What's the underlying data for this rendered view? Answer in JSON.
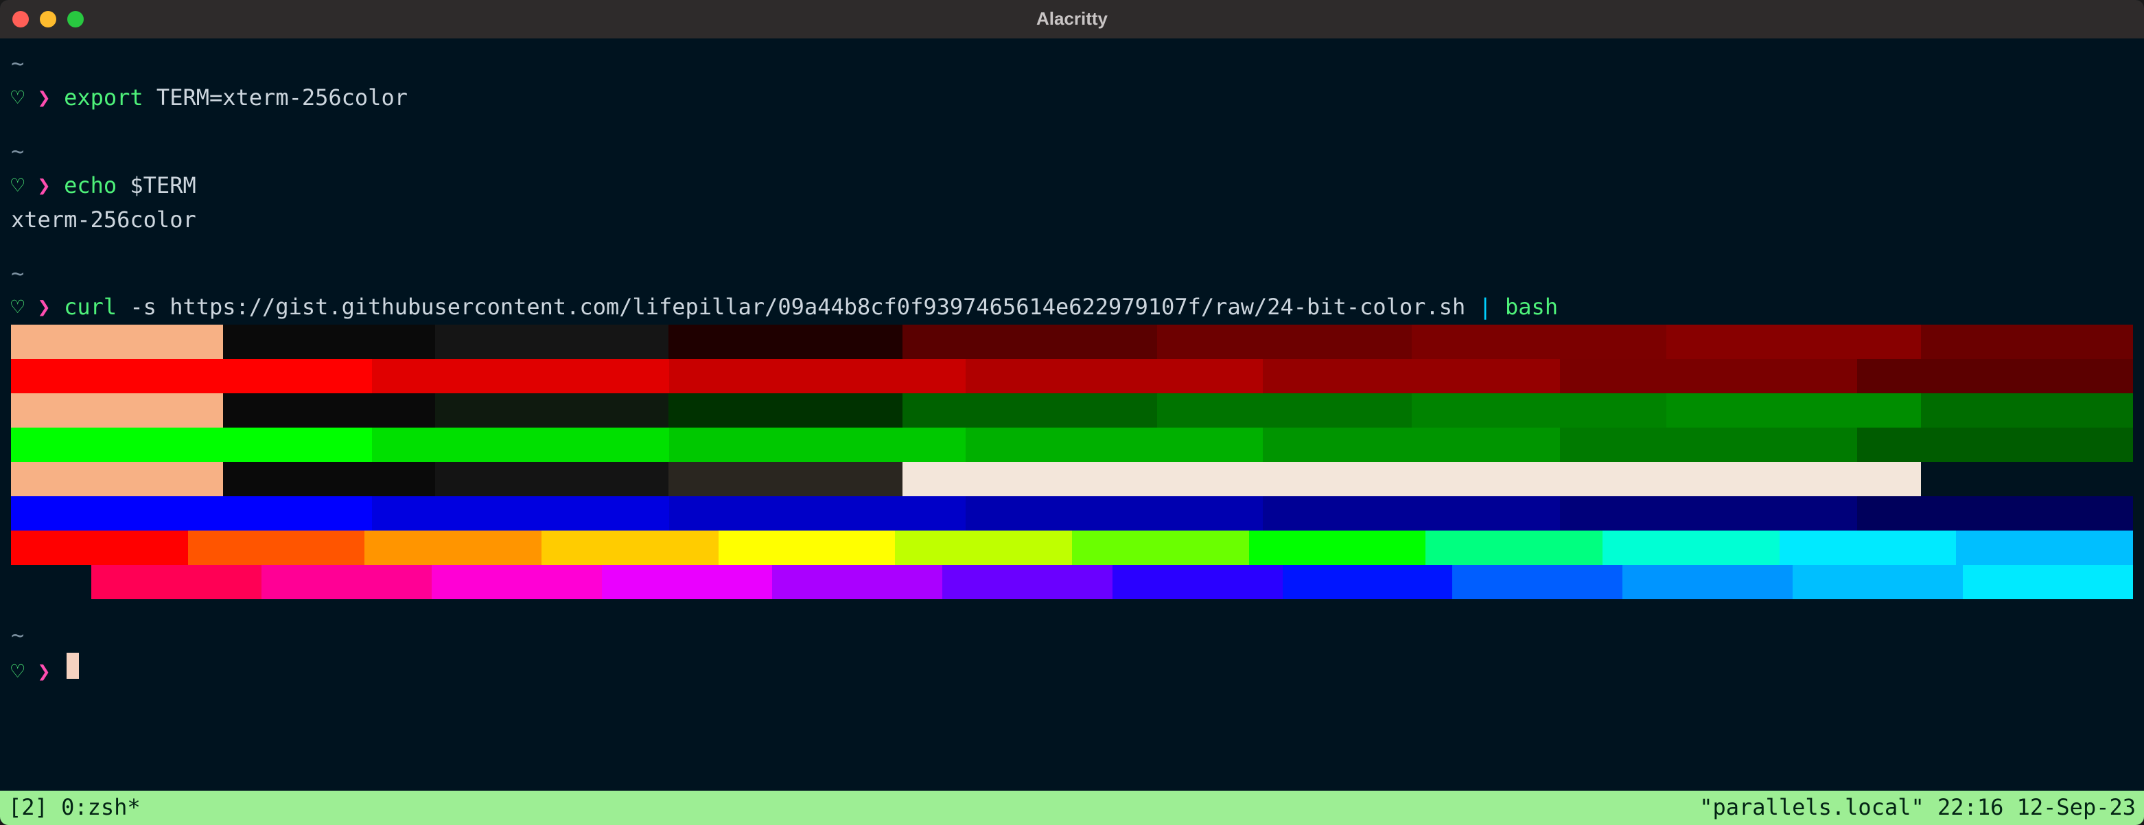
{
  "window": {
    "title": "Alacritty"
  },
  "prompt": {
    "heart": "♡",
    "chevron": "❯"
  },
  "lines": {
    "tilde": "~",
    "cmd1_cmd": "export",
    "cmd1_args": " TERM=xterm-256color",
    "cmd2_cmd": "echo",
    "cmd2_args": " $TERM",
    "output2": "xterm-256color",
    "cmd3_cmd": "curl",
    "cmd3_args": " -s https://gist.githubusercontent.com/lifepillar/09a44b8cf0f9397465614e622979107f/raw/24-bit-color.sh ",
    "cmd3_pipe": "|",
    "cmd3_bash": " bash"
  },
  "statusbar": {
    "left": "[2] 0:zsh*",
    "right": "\"parallels.local\" 22:16 12-Sep-23"
  },
  "colors": {
    "peach": "#f7b185",
    "black": "#060606",
    "nearblack1": "#131313",
    "darkred": "#5b0000",
    "darkred2": "#7d0000",
    "red": "#ff0000",
    "red2": "#d00000",
    "red3": "#a30000",
    "red4": "#720000",
    "darkgreen1": "#006a00",
    "darkgreen2": "#008500",
    "darkgreen3": "#009f00",
    "green": "#00ff00",
    "green2": "#00d600",
    "green3": "#00b000",
    "offwhite": "#f3e6da",
    "darkblue1": "#000060",
    "darkblue2": "#000090",
    "blue": "#0000ff",
    "blue2": "#0028ff",
    "blue3": "#0050ff"
  }
}
